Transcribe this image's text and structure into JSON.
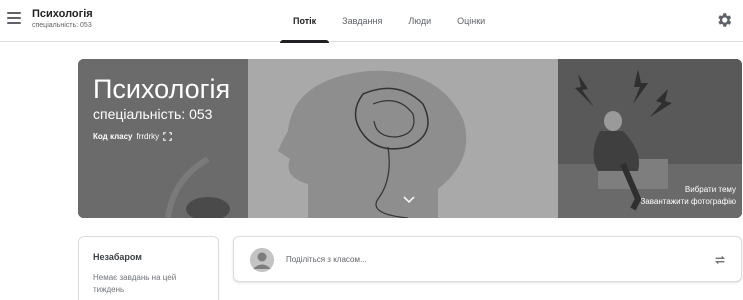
{
  "header": {
    "course_title": "Психологія",
    "course_subtitle": "спеціальність: 053",
    "tabs": [
      {
        "label": "Потік",
        "active": true
      },
      {
        "label": "Завдання",
        "active": false
      },
      {
        "label": "Люди",
        "active": false
      },
      {
        "label": "Оцінки",
        "active": false
      }
    ],
    "menu_icon": "hamburger-menu-icon",
    "settings_icon": "gear-icon"
  },
  "banner": {
    "title": "Психологія",
    "subtitle": "спеціальність: 053",
    "class_code_label": "Код класу",
    "class_code_value": "frrdrky",
    "choose_theme": "Вибрати тему",
    "upload_photo": "Завантажити фотографію"
  },
  "upcoming": {
    "title": "Незабаром",
    "text": "Немає завдань на цей тиждень"
  },
  "share": {
    "placeholder": "Поділіться з класом..."
  },
  "colors": {
    "accent": "#202124",
    "banner_bg": "#5a5a5a"
  }
}
